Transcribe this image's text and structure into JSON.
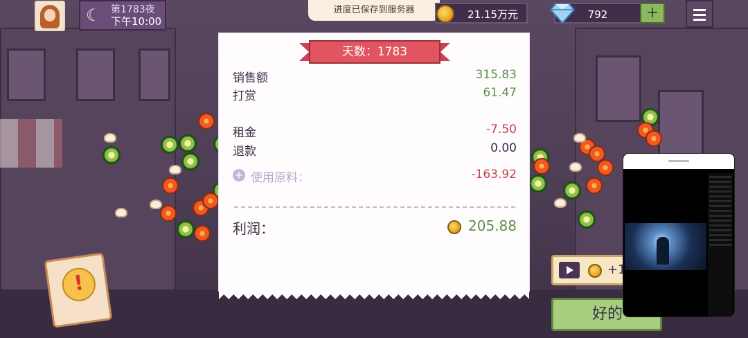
{
  "header": {
    "day_label": "第1783夜",
    "time_label": "下午10:00",
    "money": "21.15万元",
    "gems": "792",
    "plus_label": "+",
    "toast": "进度已保存到服务器"
  },
  "receipt": {
    "ribbon": "天数：1783",
    "rows": [
      {
        "label": "销售额",
        "value": "315.83"
      },
      {
        "label": "打赏",
        "value": "61.47"
      },
      {
        "label": "租金",
        "value": "-7.50"
      },
      {
        "label": "退款",
        "value": "0.00"
      },
      {
        "label": "使用原料：",
        "value": "-163.92"
      }
    ],
    "profit_label": "利润：",
    "profit_value": "205.88"
  },
  "buttons": {
    "ad_reward": "+1",
    "ok": "好的"
  },
  "colors": {
    "positive": "#5d8f4a",
    "negative": "#c0404d",
    "ribbon": "#e0555f",
    "ok_button": "#a8cf80"
  },
  "icons": {
    "moon": "crescent-moon-icon",
    "coin": "coin-icon",
    "gem": "diamond-icon",
    "menu": "hamburger-menu-icon",
    "alert": "exclamation-icon",
    "video": "play-video-icon"
  }
}
